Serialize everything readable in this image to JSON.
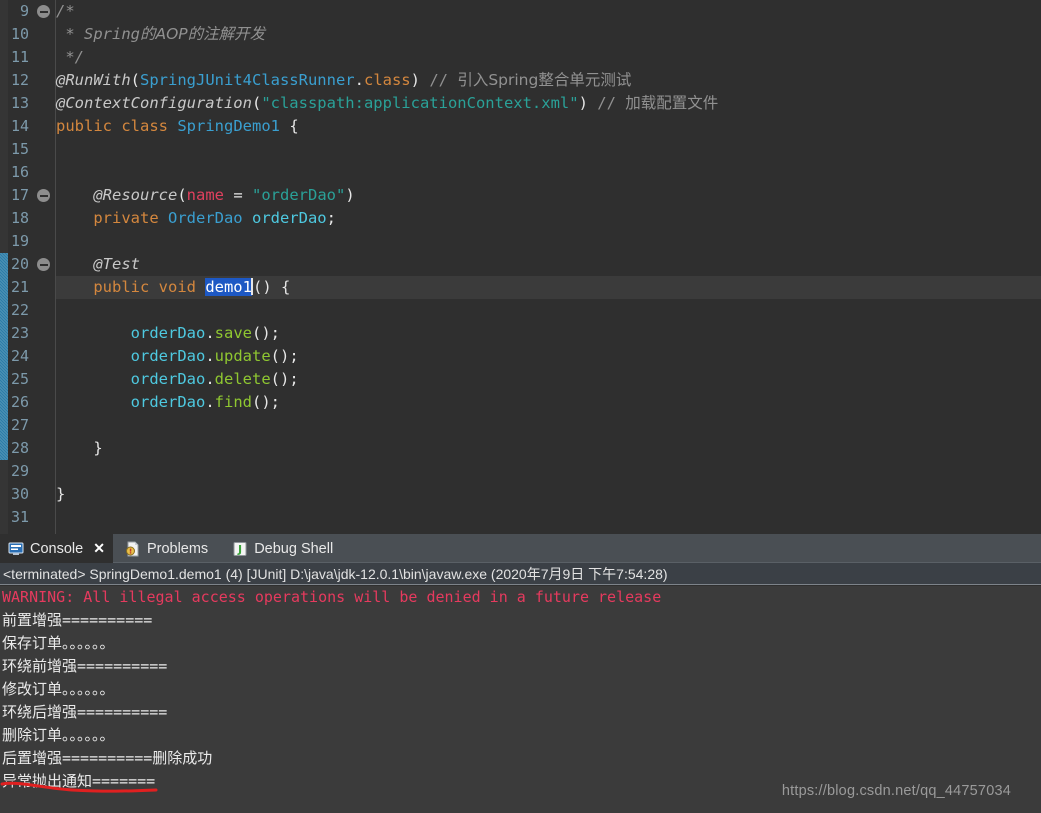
{
  "editor": {
    "first_line_number": 9,
    "current_line_number": 21,
    "selection_text": "demo1",
    "fold_marker_lines": [
      9,
      17,
      20
    ],
    "range_bar_lines": [
      20,
      28
    ],
    "colors": {
      "background": "#2f2f2f",
      "gutter_text": "#7d9aab",
      "keyword": "#d4873e",
      "type": "#3a9fd0",
      "string": "#2aa198",
      "comment": "#919191",
      "field": "#4ec9e0",
      "method": "#8fc731",
      "parameter": "#e0405e",
      "selection": "#1d58c4",
      "current_line": "#3b3b3b"
    },
    "lines": [
      {
        "n": 9,
        "segments": [
          {
            "t": "/*",
            "c": "cmt"
          }
        ]
      },
      {
        "n": 10,
        "segments": [
          {
            "t": " * Spring",
            "c": "cmt"
          },
          {
            "t": "的AOP的注解开发",
            "c": "cmt cn"
          }
        ]
      },
      {
        "n": 11,
        "segments": [
          {
            "t": " */",
            "c": "cmt"
          }
        ]
      },
      {
        "n": 12,
        "segments": [
          {
            "t": "@RunWith",
            "c": "ann"
          },
          {
            "t": "(",
            "c": "punct"
          },
          {
            "t": "SpringJUnit4ClassRunner",
            "c": "type"
          },
          {
            "t": ".",
            "c": "punct"
          },
          {
            "t": "class",
            "c": "orange"
          },
          {
            "t": ")",
            "c": "punct"
          },
          {
            "t": " // ",
            "c": "cmt2"
          },
          {
            "t": "引入Spring整合单元测试",
            "c": "cmt2 cn"
          }
        ]
      },
      {
        "n": 13,
        "segments": [
          {
            "t": "@ContextConfiguration",
            "c": "ann"
          },
          {
            "t": "(",
            "c": "punct"
          },
          {
            "t": "\"classpath:applicationContext.xml\"",
            "c": "str"
          },
          {
            "t": ")",
            "c": "punct"
          },
          {
            "t": " // ",
            "c": "cmt2"
          },
          {
            "t": "加载配置文件",
            "c": "cmt2 cn"
          }
        ]
      },
      {
        "n": 14,
        "segments": [
          {
            "t": "public class ",
            "c": "kw"
          },
          {
            "t": "SpringDemo1",
            "c": "type"
          },
          {
            "t": " {",
            "c": "punct"
          }
        ]
      },
      {
        "n": 15,
        "segments": []
      },
      {
        "n": 16,
        "segments": []
      },
      {
        "n": 17,
        "segments": [
          {
            "t": "    ",
            "c": "punct"
          },
          {
            "t": "@Resource",
            "c": "ann"
          },
          {
            "t": "(",
            "c": "punct"
          },
          {
            "t": "name",
            "c": "param"
          },
          {
            "t": " = ",
            "c": "punct"
          },
          {
            "t": "\"orderDao\"",
            "c": "str"
          },
          {
            "t": ")",
            "c": "punct"
          }
        ]
      },
      {
        "n": 18,
        "segments": [
          {
            "t": "    ",
            "c": "punct"
          },
          {
            "t": "private ",
            "c": "kw"
          },
          {
            "t": "OrderDao",
            "c": "type"
          },
          {
            "t": " ",
            "c": "punct"
          },
          {
            "t": "orderDao",
            "c": "field"
          },
          {
            "t": ";",
            "c": "punct"
          }
        ]
      },
      {
        "n": 19,
        "segments": []
      },
      {
        "n": 20,
        "segments": [
          {
            "t": "    ",
            "c": "punct"
          },
          {
            "t": "@Test",
            "c": "ann"
          }
        ]
      },
      {
        "n": 21,
        "segments": [
          {
            "t": "    ",
            "c": "punct"
          },
          {
            "t": "public void ",
            "c": "kw"
          },
          {
            "t": "demo1",
            "c": "sel"
          },
          {
            "t": "|",
            "c": "caret"
          },
          {
            "t": "() {",
            "c": "punct"
          }
        ]
      },
      {
        "n": 22,
        "segments": []
      },
      {
        "n": 23,
        "segments": [
          {
            "t": "        ",
            "c": "punct"
          },
          {
            "t": "orderDao",
            "c": "field"
          },
          {
            "t": ".",
            "c": "punct"
          },
          {
            "t": "save",
            "c": "method"
          },
          {
            "t": "();",
            "c": "punct"
          }
        ]
      },
      {
        "n": 24,
        "segments": [
          {
            "t": "        ",
            "c": "punct"
          },
          {
            "t": "orderDao",
            "c": "field"
          },
          {
            "t": ".",
            "c": "punct"
          },
          {
            "t": "update",
            "c": "method"
          },
          {
            "t": "();",
            "c": "punct"
          }
        ]
      },
      {
        "n": 25,
        "segments": [
          {
            "t": "        ",
            "c": "punct"
          },
          {
            "t": "orderDao",
            "c": "field"
          },
          {
            "t": ".",
            "c": "punct"
          },
          {
            "t": "delete",
            "c": "method"
          },
          {
            "t": "();",
            "c": "punct"
          }
        ]
      },
      {
        "n": 26,
        "segments": [
          {
            "t": "        ",
            "c": "punct"
          },
          {
            "t": "orderDao",
            "c": "field"
          },
          {
            "t": ".",
            "c": "punct"
          },
          {
            "t": "find",
            "c": "method"
          },
          {
            "t": "();",
            "c": "punct"
          }
        ]
      },
      {
        "n": 27,
        "segments": []
      },
      {
        "n": 28,
        "segments": [
          {
            "t": "    }",
            "c": "punct"
          }
        ]
      },
      {
        "n": 29,
        "segments": []
      },
      {
        "n": 30,
        "segments": [
          {
            "t": "}",
            "c": "punct"
          }
        ]
      },
      {
        "n": 31,
        "segments": []
      }
    ]
  },
  "panel": {
    "tabs": [
      {
        "label": "Console",
        "icon": "console-icon",
        "active": true,
        "closable": true,
        "close_label": "✕"
      },
      {
        "label": "Problems",
        "icon": "problems-icon",
        "active": false,
        "closable": false
      },
      {
        "label": "Debug Shell",
        "icon": "debug-shell-icon",
        "active": false,
        "closable": false
      }
    ],
    "run_status": "<terminated> SpringDemo1.demo1 (4) [JUnit] D:\\java\\jdk-12.0.1\\bin\\javaw.exe (2020年7月9日 下午7:54:28)",
    "console_lines": [
      {
        "text": "WARNING: All illegal access operations will be denied in a future release",
        "level": "error"
      },
      {
        "text": "前置增强==========",
        "level": "info"
      },
      {
        "text": "保存订单。。。。。。",
        "level": "info"
      },
      {
        "text": "环绕前增强==========",
        "level": "info"
      },
      {
        "text": "修改订单。。。。。。",
        "level": "info"
      },
      {
        "text": "环绕后增强==========",
        "level": "info"
      },
      {
        "text": "删除订单。。。。。。",
        "level": "info"
      },
      {
        "text": "后置增强==========删除成功",
        "level": "info"
      },
      {
        "text": "异常抛出通知=======",
        "level": "info"
      }
    ]
  },
  "annotation": {
    "underline_color": "#e02020",
    "underline_target": "异常抛出通知======="
  },
  "watermark": {
    "text": "https://blog.csdn.net/qq_44757034"
  }
}
